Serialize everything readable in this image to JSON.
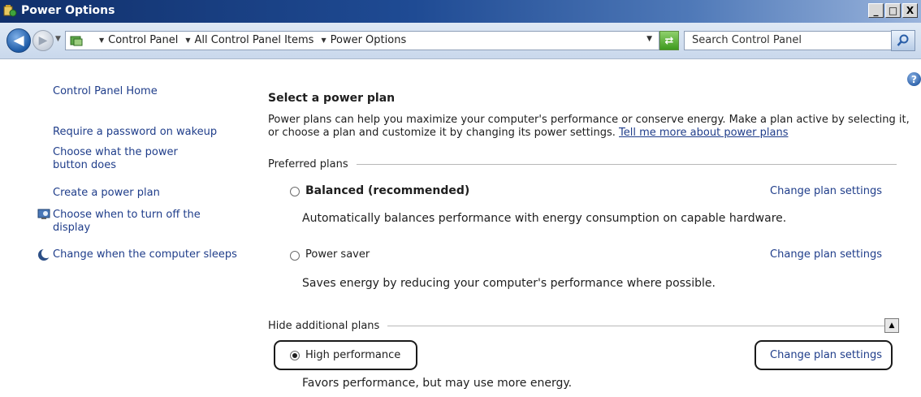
{
  "window": {
    "title": "Power Options",
    "minimize": "_",
    "maximize": "□",
    "close": "X"
  },
  "address": {
    "crumbs": [
      "Control Panel",
      "All Control Panel Items",
      "Power Options"
    ],
    "search_placeholder": "Search Control Panel"
  },
  "sidebar": {
    "items": [
      {
        "label": "Control Panel Home",
        "icon": ""
      },
      {
        "label": "Require a password on wakeup",
        "icon": ""
      },
      {
        "label": "Choose what the power button does",
        "icon": ""
      },
      {
        "label": "Create a power plan",
        "icon": ""
      },
      {
        "label": "Choose when to turn off the display",
        "icon": "display-icon"
      },
      {
        "label": "Change when the computer sleeps",
        "icon": "sleep-moon-icon"
      }
    ]
  },
  "main": {
    "heading": "Select a power plan",
    "description": "Power plans can help you maximize your computer's performance or conserve energy. Make a plan active by selecting it, or choose a plan and customize it by changing its power settings.",
    "learn_more_link": "Tell me more about power plans",
    "preferred_header": "Preferred plans",
    "additional_header": "Hide additional plans",
    "change_settings_label": "Change plan settings",
    "plans": [
      {
        "name": "Balanced (recommended)",
        "description": "Automatically balances performance with energy consumption on capable hardware.",
        "selected": false
      },
      {
        "name": "Power saver",
        "description": "Saves energy by reducing your computer's performance where possible.",
        "selected": false
      },
      {
        "name": "High performance",
        "description": "Favors performance, but may use more energy.",
        "selected": true
      }
    ]
  },
  "colors": {
    "link": "#1f3d8a",
    "titlebar": "#1f4b94",
    "highlight_box": "#1a1a1a"
  }
}
